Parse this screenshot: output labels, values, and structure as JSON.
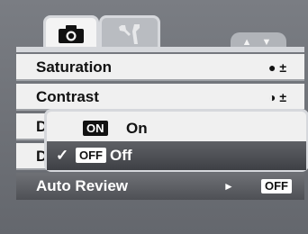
{
  "menu": {
    "items": [
      {
        "label": "Saturation",
        "trail": "● ±"
      },
      {
        "label": "Contrast",
        "trail": "◑ ±"
      },
      {
        "label": "D"
      },
      {
        "label": "D"
      },
      {
        "label": "Auto Review",
        "value_badge": "OFF"
      }
    ],
    "scroll_arrows": "▲ ▼"
  },
  "popup": {
    "options": [
      {
        "tag": "ON",
        "text": "On",
        "selected": false
      },
      {
        "tag": "OFF",
        "text": "Off",
        "selected": true,
        "check": "✓"
      }
    ]
  },
  "colors": {
    "row_bg": "#f0f0f0",
    "selected_bg": "#4e5055",
    "border": "#d6d8dc"
  }
}
